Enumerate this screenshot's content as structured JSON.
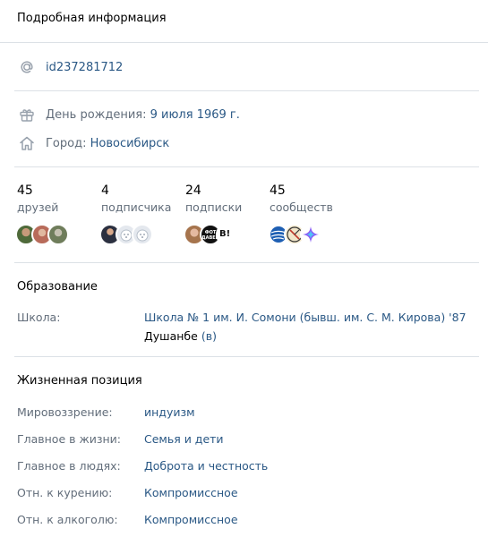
{
  "header": {
    "title": "Подробная информация"
  },
  "contacts": {
    "id": "id237281712",
    "birthday_label": "День рождения:",
    "birthday_value": "9 июля 1969 г.",
    "city_label": "Город:",
    "city_value": "Новосибирск"
  },
  "counters": [
    {
      "count": "45",
      "label": "друзей"
    },
    {
      "count": "4",
      "label": "подписчика"
    },
    {
      "count": "24",
      "label": "подписки"
    },
    {
      "count": "45",
      "label": "сообществ"
    }
  ],
  "avatar_thumbs": {
    "subscriptions_2": "ФОТ\nДАВЕЙ",
    "subscriptions_3": "B!"
  },
  "education": {
    "title": "Образование",
    "school_label": "Школа:",
    "school_value": "Школа № 1 им. И. Сомони (бывш. им. С. М. Кирова) '87",
    "school_city": "Душанбе",
    "school_city_suffix": "(в)"
  },
  "life": {
    "title": "Жизненная позиция",
    "rows": [
      {
        "label": "Мировоззрение:",
        "value": "индуизм"
      },
      {
        "label": "Главное в жизни:",
        "value": "Семья и дети"
      },
      {
        "label": "Главное в людях:",
        "value": "Доброта и честность"
      },
      {
        "label": "Отн. к курению:",
        "value": "Компромиссное"
      },
      {
        "label": "Отн. к алкоголю:",
        "value": "Компромиссное"
      }
    ]
  },
  "colors": {
    "link": "#2a5885",
    "muted": "#626d7a",
    "separator": "#dce1e6",
    "icon": "#99a2ad"
  }
}
